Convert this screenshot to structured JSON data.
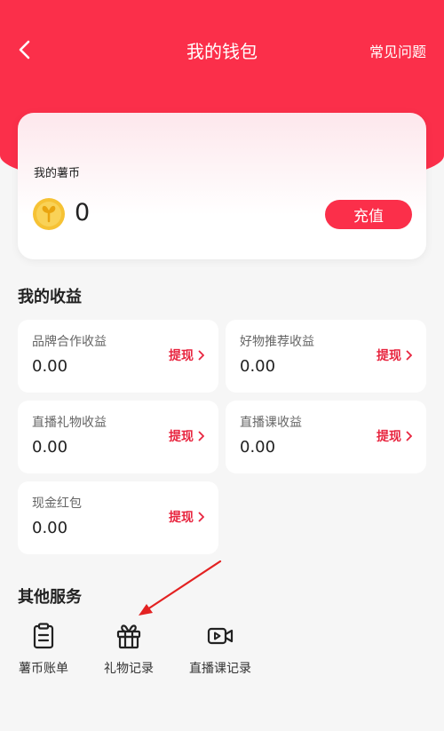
{
  "header": {
    "title": "我的钱包",
    "faq_label": "常见问题"
  },
  "wallet": {
    "label": "我的薯币",
    "balance": "0",
    "recharge_label": "充值"
  },
  "earnings": {
    "title": "我的收益",
    "withdraw_label": "提现",
    "items": [
      {
        "label": "品牌合作收益",
        "value": "0.00"
      },
      {
        "label": "好物推荐收益",
        "value": "0.00"
      },
      {
        "label": "直播礼物收益",
        "value": "0.00"
      },
      {
        "label": "直播课收益",
        "value": "0.00"
      },
      {
        "label": "现金红包",
        "value": "0.00"
      }
    ]
  },
  "services": {
    "title": "其他服务",
    "items": [
      {
        "label": "薯币账单",
        "icon": "clipboard-icon"
      },
      {
        "label": "礼物记录",
        "icon": "gift-icon"
      },
      {
        "label": "直播课记录",
        "icon": "video-icon"
      }
    ]
  },
  "colors": {
    "brand_red": "#fb2f4a",
    "withdraw_red": "#e8253f",
    "coin_gold": "#f6c234",
    "annotation_arrow": "#e32222"
  }
}
